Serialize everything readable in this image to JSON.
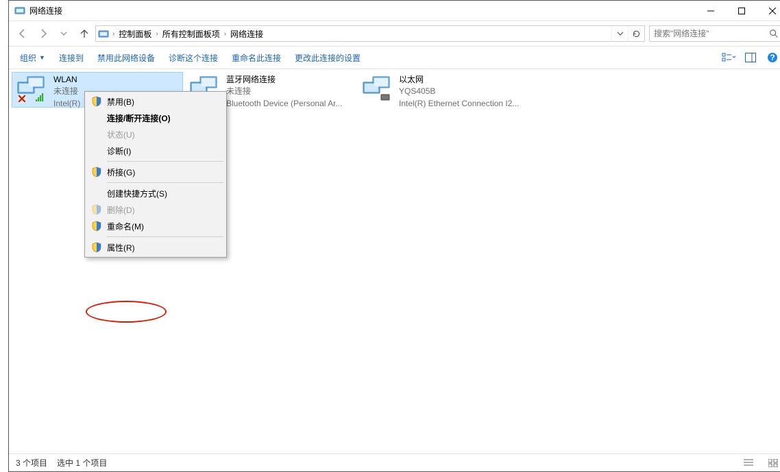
{
  "window": {
    "title": "网络连接"
  },
  "titlebar_controls": {
    "min": "minimize",
    "max": "maximize",
    "close": "close"
  },
  "nav": {
    "back": "Back",
    "forward": "Forward",
    "recent": "Recent",
    "up": "Up"
  },
  "breadcrumbs": {
    "root_icon": "control-panel",
    "items": [
      "控制面板",
      "所有控制面板项",
      "网络连接"
    ]
  },
  "address_controls": {
    "dropdown": "▾",
    "refresh": "↻"
  },
  "search": {
    "placeholder": "搜索\"网络连接\""
  },
  "commandbar": {
    "organize": "组织",
    "connect_to": "连接到",
    "disable_device": "禁用此网络设备",
    "diagnose": "诊断这个连接",
    "rename": "重命名此连接",
    "change_settings": "更改此连接的设置"
  },
  "cmdright": {
    "view_options": "view-options",
    "preview_pane": "preview-pane",
    "help": "help"
  },
  "adapters": [
    {
      "name": "WLAN",
      "status": "未连接",
      "device": "Intel(R)",
      "selected": true,
      "icon": "wifi-disconnected"
    },
    {
      "name": "蓝牙网络连接",
      "status": "未连接",
      "device": "Bluetooth Device (Personal Ar...",
      "selected": false,
      "icon": "bluetooth"
    },
    {
      "name": "以太网",
      "status": "YQS405B",
      "device": "Intel(R) Ethernet Connection I2...",
      "selected": false,
      "icon": "ethernet"
    }
  ],
  "context_menu": {
    "disable": "禁用(B)",
    "connect_disconnect": "连接/断开连接(O)",
    "status": "状态(U)",
    "diagnose": "诊断(I)",
    "bridge": "桥接(G)",
    "create_shortcut": "创建快捷方式(S)",
    "delete": "删除(D)",
    "rename": "重命名(M)",
    "properties": "属性(R)"
  },
  "statusbar": {
    "item_count": "3 个项目",
    "selection": "选中 1 个项目"
  }
}
